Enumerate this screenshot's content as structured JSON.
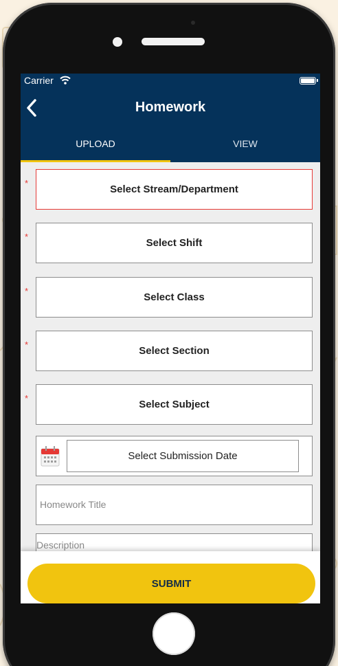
{
  "status_bar": {
    "carrier": "Carrier"
  },
  "nav": {
    "title": "Homework"
  },
  "tabs": [
    {
      "label": "UPLOAD",
      "active": true
    },
    {
      "label": "VIEW",
      "active": false
    }
  ],
  "form": {
    "required_mark": "*",
    "stream": "Select Stream/Department",
    "shift": "Select Shift",
    "class": "Select Class",
    "section": "Select Section",
    "subject": "Select Subject",
    "submission_date": "Select Submission Date",
    "title_placeholder": "Homework Title",
    "description_placeholder": "Description"
  },
  "submit_label": "SUBMIT",
  "colors": {
    "header": "#05325a",
    "accent": "#f1c40f",
    "required": "#e53935"
  }
}
